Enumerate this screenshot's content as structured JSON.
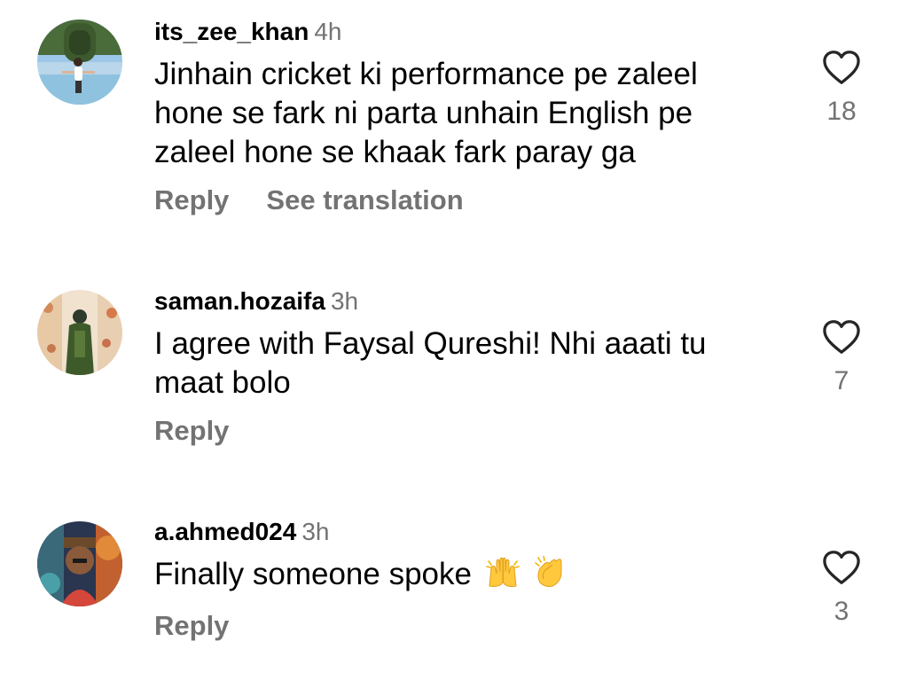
{
  "comments": [
    {
      "username": "its_zee_khan",
      "time": "4h",
      "text": "Jinhain cricket ki performance pe zaleel hone se fark ni parta unhain English pe zaleel hone se khaak fark paray ga",
      "reply_label": "Reply",
      "translate_label": "See translation",
      "likes": "18",
      "avatar_icon": "profile-photo-person-at-statue"
    },
    {
      "username": "saman.hozaifa",
      "time": "3h",
      "text": "I agree with Faysal Qureshi! Nhi aaati tu maat bolo",
      "reply_label": "Reply",
      "likes": "7",
      "avatar_icon": "profile-photo-woman-green-dress"
    },
    {
      "username": "a.ahmed024",
      "time": "3h",
      "text": "Finally someone spoke",
      "emoji": [
        "raising-hands-emoji",
        "clapping-hands-emoji"
      ],
      "reply_label": "Reply",
      "likes": "3",
      "avatar_icon": "profile-photo-colorful-portrait"
    }
  ],
  "colors": {
    "primary_text": "#000000",
    "secondary_text": "#737373",
    "heart_outline": "#262626",
    "emoji_yellow": "#ffc83d"
  }
}
